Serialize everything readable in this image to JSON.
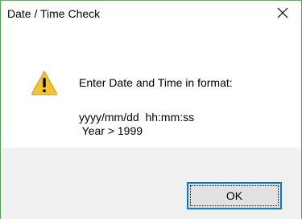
{
  "window": {
    "title": "Date / Time Check",
    "close_icon": "close-icon"
  },
  "message": {
    "icon": "warning-icon",
    "line1": "Enter Date and Time in format:",
    "line2": "yyyy/mm/dd  hh:mm:ss",
    "line3": " Year > 1999"
  },
  "buttons": {
    "ok_label": "OK"
  },
  "colors": {
    "accent": "#0078d7",
    "footer_bg": "#f0f0f0",
    "window_border": "#5a9a5a",
    "warning_fill": "#f4c430"
  }
}
